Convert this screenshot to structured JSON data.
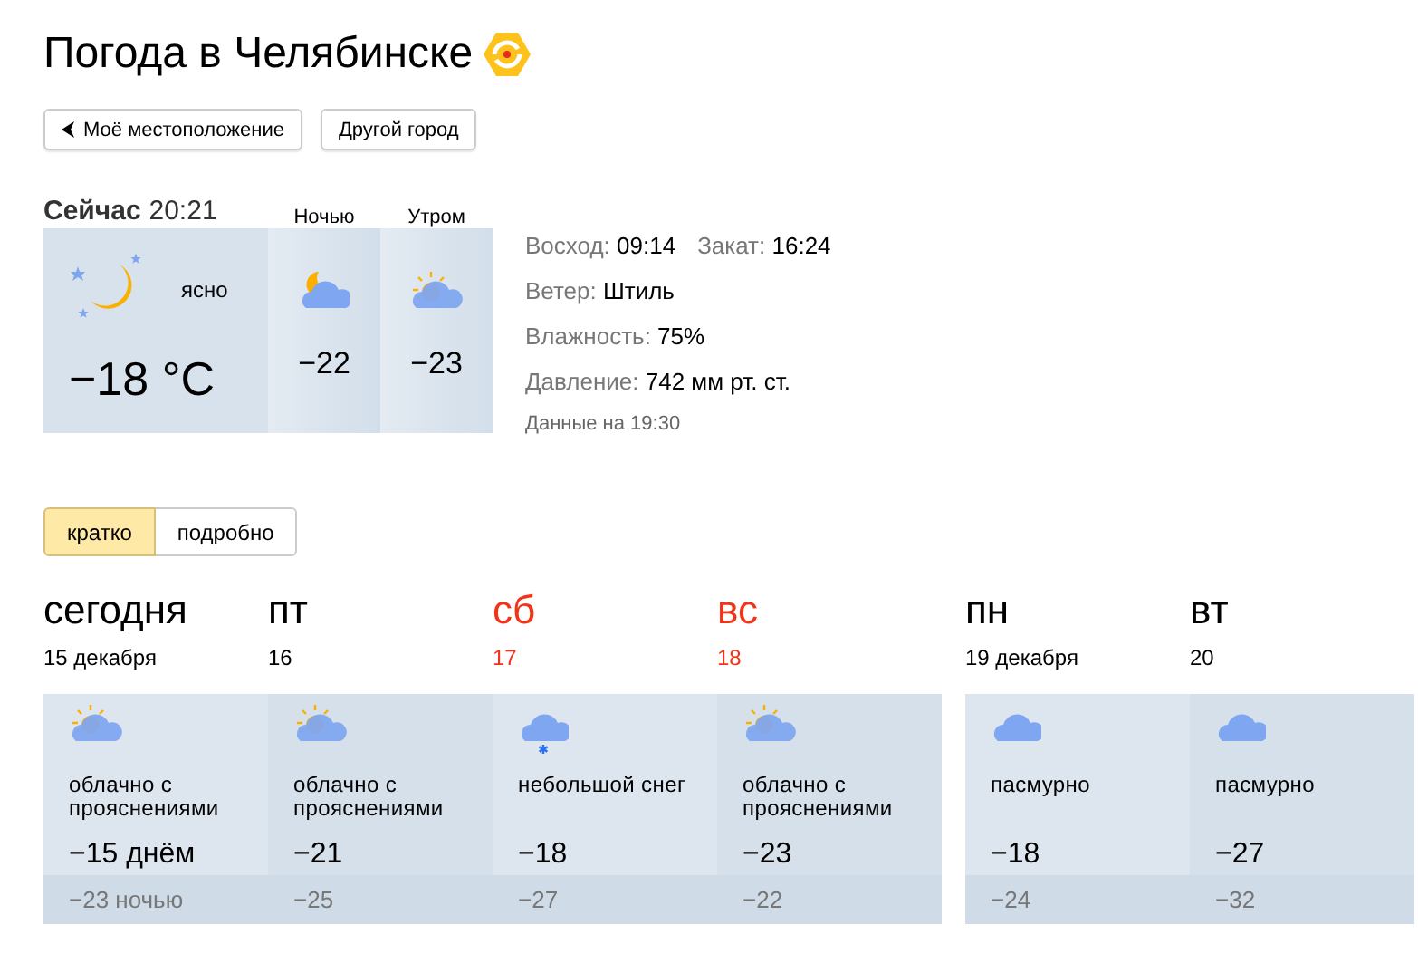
{
  "title": "Погода в Челябинске",
  "buttons": [
    {
      "label": "Моё местоположение",
      "kind": "location"
    },
    {
      "label": "Другой город",
      "kind": "plain"
    }
  ],
  "now": {
    "label": "Сейчас",
    "time": "20:21",
    "condition": "ясно",
    "temp": "−18 °C",
    "kind": "clear-night"
  },
  "periods": [
    {
      "label": "Ночью",
      "temp": "−22",
      "kind": "night-cloudy"
    },
    {
      "label": "Утром",
      "temp": "−23",
      "kind": "partly-cloudy"
    }
  ],
  "details": [
    [
      {
        "label": "Восход:",
        "value": "09:14"
      },
      {
        "label": "Закат:",
        "value": "16:24"
      }
    ],
    [
      {
        "label": "Ветер:",
        "value": "Штиль"
      }
    ],
    [
      {
        "label": "Влажность:",
        "value": "75%"
      }
    ],
    [
      {
        "label": "Давление:",
        "value": "742 мм рт. ст."
      }
    ]
  ],
  "data_time": "Данные на 19:30",
  "tabs": [
    {
      "label": "кратко",
      "selected": true
    },
    {
      "label": "подробно",
      "selected": false
    }
  ],
  "weeks": [
    {
      "days": [
        {
          "name": "сегодня",
          "date": "15 декабря",
          "weekend": false,
          "kind": "partly-cloudy",
          "condition": "облачно с прояснениями",
          "day_temp": "−15 днём",
          "night_temp": "−23 ночью"
        },
        {
          "name": "пт",
          "date": "16",
          "weekend": false,
          "kind": "partly-cloudy",
          "condition": "облачно с прояснениями",
          "day_temp": "−21",
          "night_temp": "−25"
        },
        {
          "name": "сб",
          "date": "17",
          "weekend": true,
          "kind": "snow",
          "condition": "небольшой снег",
          "day_temp": "−18",
          "night_temp": "−27"
        },
        {
          "name": "вс",
          "date": "18",
          "weekend": true,
          "kind": "partly-cloudy",
          "condition": "облачно с прояснениями",
          "day_temp": "−23",
          "night_temp": "−22"
        }
      ]
    },
    {
      "days": [
        {
          "name": "пн",
          "date": "19 декабря",
          "weekend": false,
          "kind": "overcast",
          "condition": "пасмурно",
          "day_temp": "−18",
          "night_temp": "−24"
        },
        {
          "name": "вт",
          "date": "20",
          "weekend": false,
          "kind": "overcast",
          "condition": "пасмурно",
          "day_temp": "−27",
          "night_temp": "−32"
        }
      ]
    }
  ]
}
